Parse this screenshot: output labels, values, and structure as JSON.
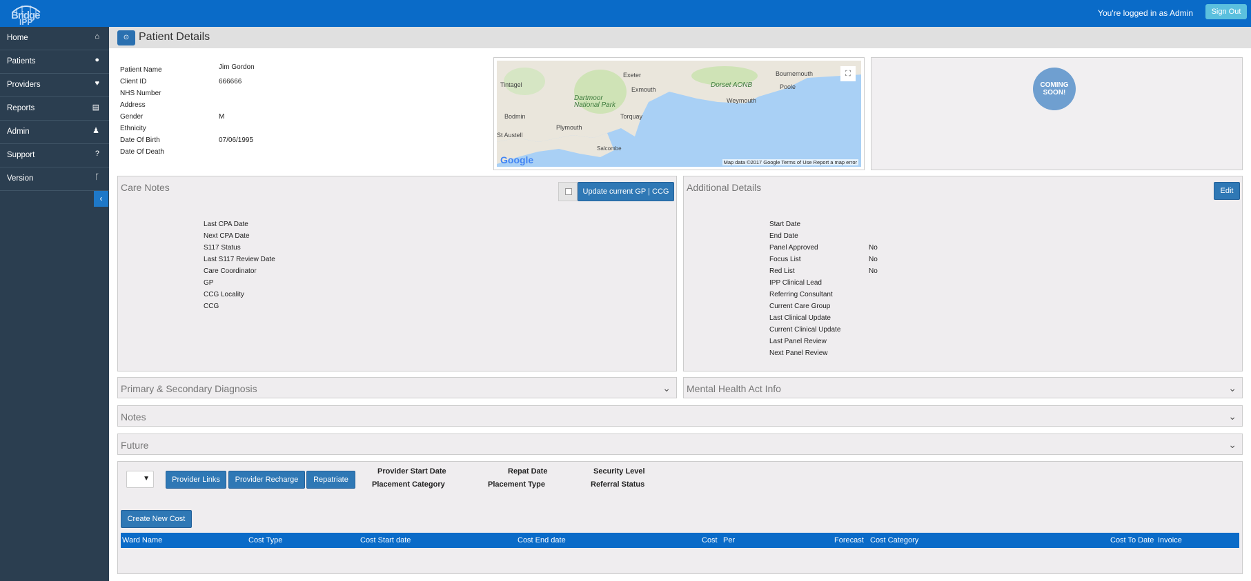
{
  "app": {
    "logo_line1": "Bridge",
    "logo_line2": "IPP"
  },
  "topbar": {
    "logged_in_text": "You're logged in as Admin",
    "signout_label": "Sign Out"
  },
  "sidebar": {
    "items": [
      {
        "label": "Home",
        "icon": "home-icon",
        "glyph": "⌂"
      },
      {
        "label": "Patients",
        "icon": "user-icon",
        "glyph": "●"
      },
      {
        "label": "Providers",
        "icon": "heartbeat-icon",
        "glyph": "♥"
      },
      {
        "label": "Reports",
        "icon": "book-icon",
        "glyph": "▤"
      },
      {
        "label": "Admin",
        "icon": "users-icon",
        "glyph": "♟"
      },
      {
        "label": "Support",
        "icon": "question-icon",
        "glyph": "?"
      },
      {
        "label": "Version",
        "icon": "branch-icon",
        "glyph": "ᚴ"
      }
    ],
    "collapse_glyph": "‹"
  },
  "page": {
    "title": "Patient Details",
    "back_glyph": "⊙"
  },
  "patient": {
    "fields": [
      {
        "label": "Patient Name",
        "value": "Jim Gordon"
      },
      {
        "label": "Client ID",
        "value": "666666"
      },
      {
        "label": "NHS Number",
        "value": ""
      },
      {
        "label": "Address",
        "value": ""
      },
      {
        "label": "Gender",
        "value": "M"
      },
      {
        "label": "Ethnicity",
        "value": ""
      },
      {
        "label": "Date Of Birth",
        "value": "07/06/1995"
      },
      {
        "label": "Date Of Death",
        "value": ""
      }
    ]
  },
  "map": {
    "places": [
      "Exeter",
      "Bournemouth",
      "Tintagel",
      "Exmouth",
      "Poole",
      "Weymouth",
      "Bodmin",
      "Torquay",
      "Plymouth",
      "St Austell",
      "Salcombe"
    ],
    "parks": [
      "Dartmoor National Park",
      "Dorset AONB"
    ],
    "google_label": "Google",
    "attribution": "Map data ©2017 Google   Terms of Use   Report a map error"
  },
  "coming_soon": {
    "text": "COMING SOON!"
  },
  "care_notes": {
    "title": "Care Notes",
    "update_button": "Update current GP | CCG",
    "fields": [
      "Last CPA Date",
      "Next CPA Date",
      "S117 Status",
      "Last S117 Review Date",
      "Care Coordinator",
      "GP",
      "CCG Locality",
      "CCG"
    ]
  },
  "additional": {
    "title": "Additional Details",
    "edit_button": "Edit",
    "fields": [
      {
        "label": "Start Date",
        "value": ""
      },
      {
        "label": "End Date",
        "value": ""
      },
      {
        "label": "Panel Approved",
        "value": "No"
      },
      {
        "label": "Focus List",
        "value": "No"
      },
      {
        "label": "Red List",
        "value": "No"
      },
      {
        "label": "IPP Clinical Lead",
        "value": ""
      },
      {
        "label": "Referring Consultant",
        "value": ""
      },
      {
        "label": "Current Care Group",
        "value": ""
      },
      {
        "label": "Last Clinical Update",
        "value": ""
      },
      {
        "label": "Current Clinical Update",
        "value": ""
      },
      {
        "label": "Last Panel Review",
        "value": ""
      },
      {
        "label": "Next Panel Review",
        "value": ""
      }
    ]
  },
  "accordions": {
    "diagnosis": "Primary & Secondary Diagnosis",
    "mha": "Mental Health Act Info",
    "notes": "Notes",
    "future": "Future",
    "chevron": "⌄"
  },
  "provider": {
    "select_arrow": "▼",
    "buttons": [
      "Provider Links",
      "Provider Recharge",
      "Repatriate"
    ],
    "labels": [
      "Provider Start Date",
      "Repat Date",
      "Security Level",
      "Placement Category",
      "Placement Type",
      "Referral Status"
    ],
    "create_cost": "Create New Cost",
    "columns": [
      "Ward Name",
      "Cost Type",
      "Cost Start date",
      "Cost End date",
      "Cost",
      "Per",
      "Forecast",
      "Cost Category",
      "Cost To Date",
      "Invoice"
    ]
  },
  "colors": {
    "brand": "#0a6bc8",
    "sidebar": "#2b3e50",
    "button": "#2f78b5",
    "signout": "#5bc0de"
  }
}
